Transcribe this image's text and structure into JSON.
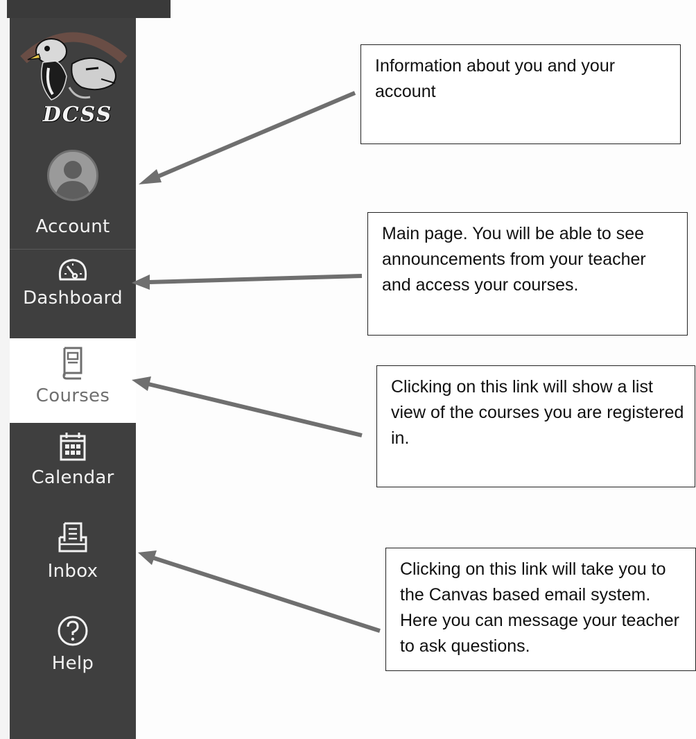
{
  "sidebar": {
    "logo_text": "DCSS",
    "items": [
      {
        "label": "Account",
        "icon": "avatar-icon"
      },
      {
        "label": "Dashboard",
        "icon": "dashboard-icon"
      },
      {
        "label": "Courses",
        "icon": "book-icon",
        "active": true
      },
      {
        "label": "Calendar",
        "icon": "calendar-icon"
      },
      {
        "label": "Inbox",
        "icon": "inbox-icon"
      },
      {
        "label": "Help",
        "icon": "help-icon"
      }
    ],
    "background": "#3f3f3f",
    "active_background": "#ffffff"
  },
  "callouts": [
    {
      "text": "Information about you and your account"
    },
    {
      "text": "Main page.  You will be able to see announcements from your teacher and access your courses."
    },
    {
      "text": "Clicking on this link will show a list view of the courses you are registered in."
    },
    {
      "text": "Clicking on this link will take you to the Canvas based email system.  Here you can message your teacher to ask questions."
    }
  ],
  "arrow_color": "#6f6f6f"
}
